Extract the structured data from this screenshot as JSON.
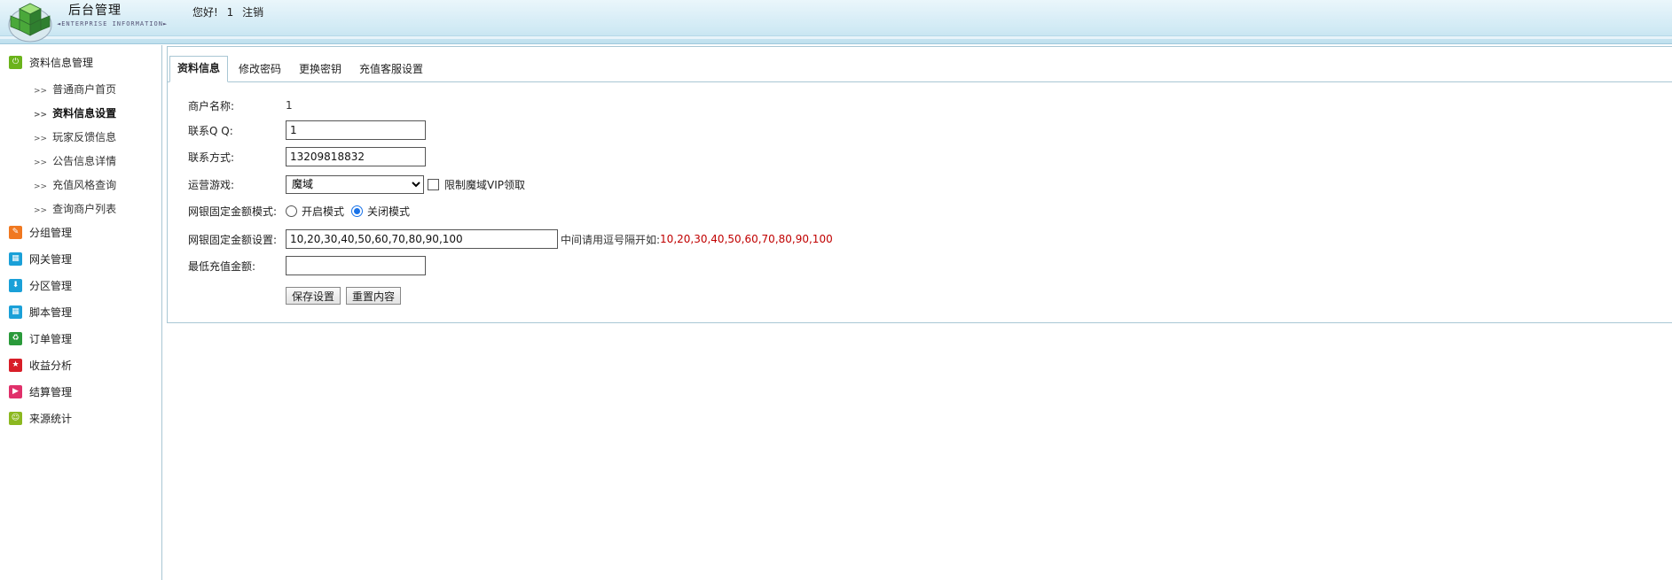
{
  "header": {
    "title": "后台管理",
    "subtitle": "◄ENTERPRISE INFORMATION►",
    "greeting": "您好!",
    "username": "1",
    "logout": "注销"
  },
  "sidebar": {
    "groups": [
      {
        "label": "资料信息管理",
        "icon": "power-icon",
        "color": "#6bb31b"
      },
      {
        "label": "分组管理",
        "icon": "pencil-icon",
        "color": "#f07820"
      },
      {
        "label": "网关管理",
        "icon": "grid-icon",
        "color": "#1aa0d8"
      },
      {
        "label": "分区管理",
        "icon": "download-icon",
        "color": "#1aa0d8"
      },
      {
        "label": "脚本管理",
        "icon": "grid-icon",
        "color": "#1aa0d8"
      },
      {
        "label": "订单管理",
        "icon": "recycle-icon",
        "color": "#2a9a3a"
      },
      {
        "label": "收益分析",
        "icon": "star-icon",
        "color": "#d81e28"
      },
      {
        "label": "结算管理",
        "icon": "play-icon",
        "color": "#e0306a"
      },
      {
        "label": "来源统计",
        "icon": "smile-icon",
        "color": "#8cb820"
      }
    ],
    "sub_items": [
      {
        "label": "普通商户首页"
      },
      {
        "label": "资料信息设置"
      },
      {
        "label": "玩家反馈信息"
      },
      {
        "label": "公告信息详情"
      },
      {
        "label": "充值风格查询"
      },
      {
        "label": "查询商户列表"
      }
    ],
    "sub_arrow": ">>"
  },
  "tabs": [
    {
      "label": "资料信息"
    },
    {
      "label": "修改密码"
    },
    {
      "label": "更换密钥"
    },
    {
      "label": "充值客服设置"
    }
  ],
  "form": {
    "merchant_name_label": "商户名称:",
    "merchant_name_value": "1",
    "qq_label": "联系Q Q:",
    "qq_value": "1",
    "contact_label": "联系方式:",
    "contact_value": "13209818832",
    "game_label": "运营游戏:",
    "game_selected": "魔域",
    "vip_limit_label": "限制魔域VIP领取",
    "mode_label": "网银固定金额模式:",
    "mode_on_label": "开启模式",
    "mode_off_label": "关闭模式",
    "amounts_label": "网银固定金额设置:",
    "amounts_value": "10,20,30,40,50,60,70,80,90,100",
    "amounts_hint": "中间请用逗号隔开如:",
    "amounts_example": "10,20,30,40,50,60,70,80,90,100",
    "min_label": "最低充值金额:",
    "min_value": "",
    "save_button": "保存设置",
    "reset_button": "重置内容"
  }
}
